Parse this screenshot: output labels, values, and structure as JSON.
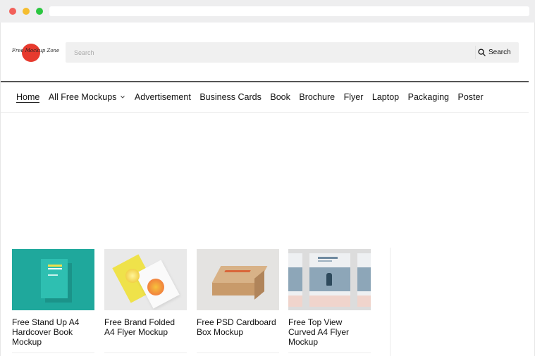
{
  "header": {
    "logo_text": "Free Mockup Zone",
    "search": {
      "placeholder": "Search",
      "button_label": "Search"
    }
  },
  "nav": {
    "items": [
      {
        "label": "Home",
        "active": true
      },
      {
        "label": "All Free Mockups",
        "dropdown": true
      },
      {
        "label": "Advertisement"
      },
      {
        "label": "Business Cards"
      },
      {
        "label": "Book"
      },
      {
        "label": "Brochure"
      },
      {
        "label": "Flyer"
      },
      {
        "label": "Laptop"
      },
      {
        "label": "Packaging"
      },
      {
        "label": "Poster"
      }
    ]
  },
  "posts": [
    {
      "title": "Free Stand Up A4 Hardcover Book Mockup"
    },
    {
      "title": "Free Brand Folded A4 Flyer Mockup"
    },
    {
      "title": "Free PSD Cardboard Box Mockup"
    },
    {
      "title": "Free Top View Curved A4 Flyer Mockup"
    }
  ],
  "colors": {
    "logo_red": "#e73a2e",
    "search_bg": "#f0f0f0",
    "header_rule": "#555555"
  },
  "icons": {
    "search": "search-icon",
    "chevron": "chevron-down-icon"
  }
}
